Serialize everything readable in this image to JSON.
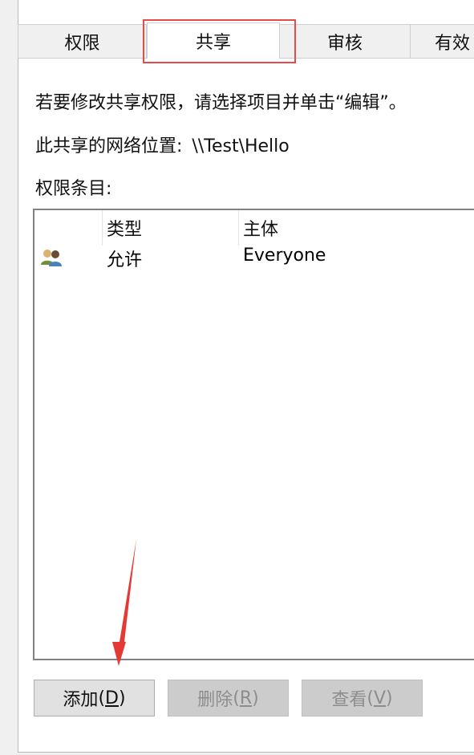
{
  "tabs": [
    {
      "label": "权限"
    },
    {
      "label": "共享"
    },
    {
      "label": "审核"
    },
    {
      "label": "有效"
    }
  ],
  "content": {
    "instruction": "若要修改共享权限，请选择项目并单击“编辑”。",
    "network_location_label": "此共享的网络位置:",
    "network_location_value": "\\\\Test\\Hello",
    "permission_entries_label": "权限条目:"
  },
  "list": {
    "columns": [
      "类型",
      "主体"
    ],
    "rows": [
      {
        "type": "允许",
        "subject": "Everyone",
        "icon": "users-icon"
      }
    ]
  },
  "buttons": {
    "add": {
      "label": "添加",
      "mnemonic": "D"
    },
    "remove": {
      "label": "删除",
      "mnemonic": "R"
    },
    "view": {
      "label": "查看",
      "mnemonic": "V"
    }
  },
  "colors": {
    "highlight": "#e44c4c",
    "arrow": "#e53935"
  }
}
